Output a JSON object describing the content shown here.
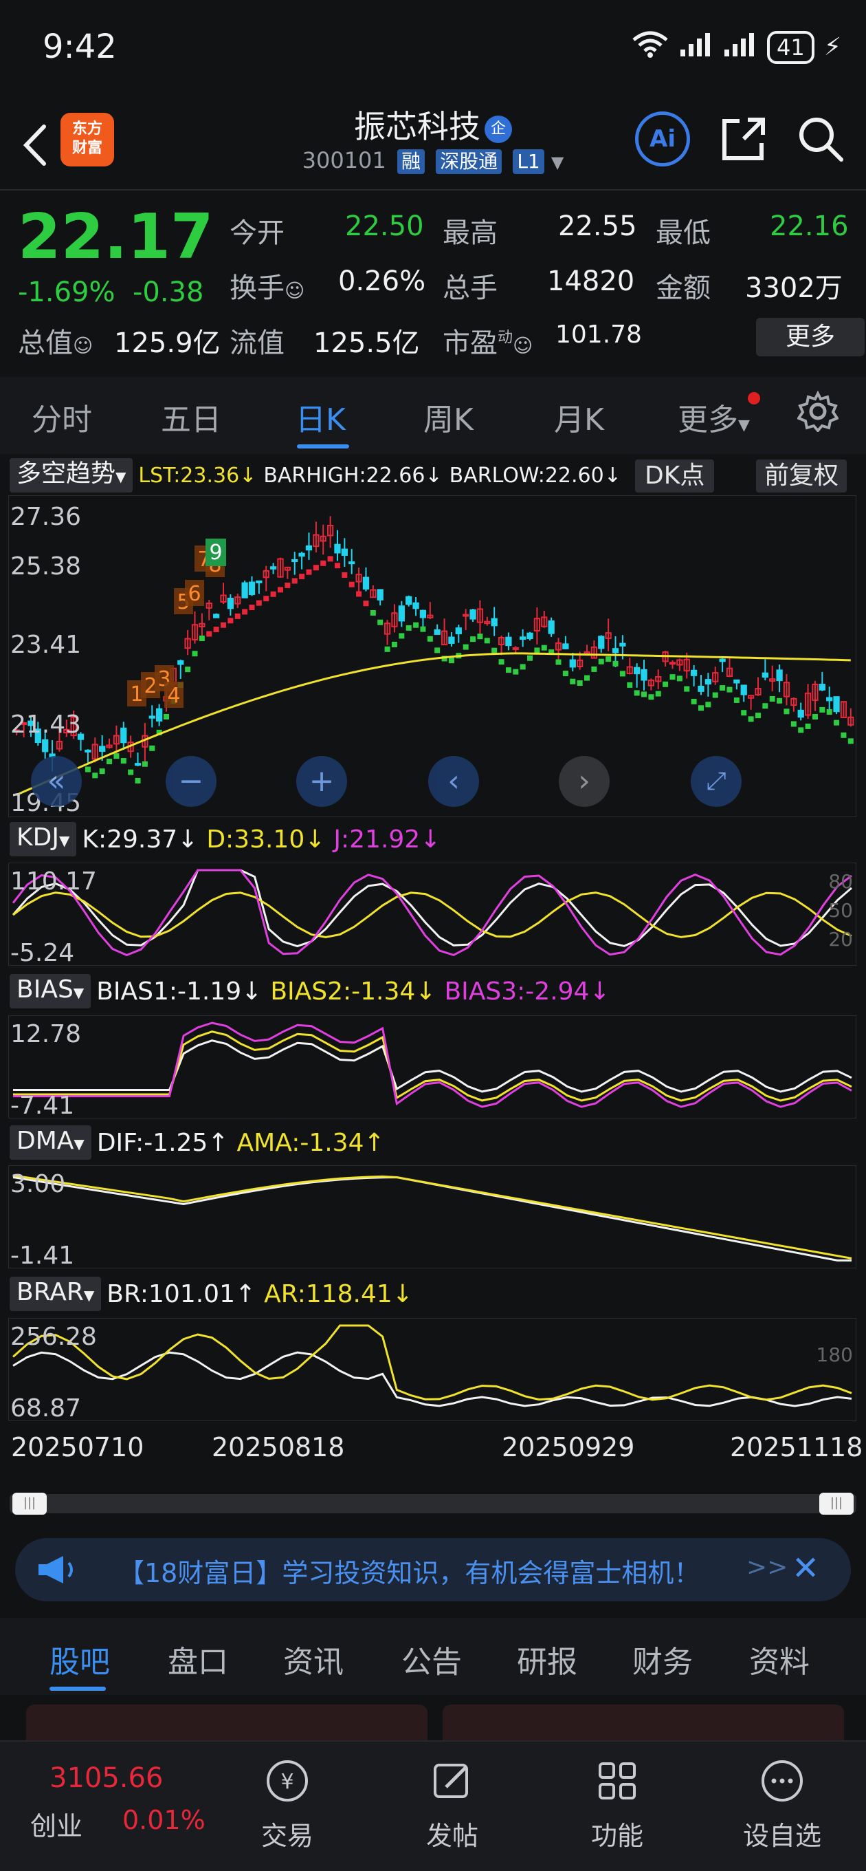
{
  "status": {
    "time": "9:42",
    "battery": "41"
  },
  "header": {
    "logo_line1": "东方",
    "logo_line2": "财富",
    "name": "振芯科技",
    "name_badge": "企",
    "code": "300101",
    "tags": [
      "融",
      "深股通",
      "L1"
    ],
    "ai_label": "Ai"
  },
  "quote": {
    "price": "22.17",
    "change_pct": "-1.69%",
    "change_amt": "-0.38",
    "open_label": "今开",
    "open": "22.50",
    "high_label": "最高",
    "high": "22.55",
    "low_label": "最低",
    "low": "22.16",
    "turnover_label": "换手",
    "turnover": "0.26%",
    "volume_label": "总手",
    "volume": "14820",
    "amount_label": "金额",
    "amount": "3302万",
    "mktcap_label": "总值",
    "mktcap": "125.9亿",
    "float_label": "流值",
    "float": "125.5亿",
    "pe_label": "市盈",
    "pe_sup": "动",
    "pe": "101.78",
    "more": "更多"
  },
  "period_tabs": [
    "分时",
    "五日",
    "日K",
    "周K",
    "月K",
    "更多"
  ],
  "main_indicator": {
    "name": "多空趋势",
    "lst": "LST:23.36↓",
    "barhigh": "BARHIGH:22.66↓",
    "barlow": "BARLOW:22.60↓",
    "dk": "DK点",
    "adjust": "前复权",
    "y_labels": [
      "27.36",
      "25.38",
      "23.41",
      "21.43",
      "19.45"
    ],
    "markers": [
      "1",
      "2",
      "3",
      "4",
      "5",
      "6",
      "7",
      "8",
      "9"
    ]
  },
  "kdj": {
    "name": "KDJ",
    "k": "K:29.37↓",
    "d": "D:33.10↓",
    "j": "J:21.92↓",
    "y_top": "110.17",
    "y_bot": "-5.24",
    "r1": "80",
    "r2": "50",
    "r3": "20"
  },
  "bias": {
    "name": "BIAS",
    "b1": "BIAS1:-1.19↓",
    "b2": "BIAS2:-1.34↓",
    "b3": "BIAS3:-2.94↓",
    "y_top": "12.78",
    "y_bot": "-7.41"
  },
  "dma": {
    "name": "DMA",
    "dif": "DIF:-1.25↑",
    "ama": "AMA:-1.34↑",
    "y_top": "3.00",
    "y_bot": "-1.41"
  },
  "brar": {
    "name": "BRAR",
    "br": "BR:101.01↑",
    "ar": "AR:118.41↓",
    "y_top": "256.28",
    "y_bot": "68.87",
    "r1": "180"
  },
  "dates": [
    "20250710",
    "20250818",
    "20250929",
    "20251118"
  ],
  "banner": {
    "text": "【18财富日】学习投资知识，有机会得富士相机！",
    "arrow": ">>"
  },
  "bottom_tabs": [
    "股吧",
    "盘口",
    "资讯",
    "公告",
    "研报",
    "财务",
    "资料"
  ],
  "nav": {
    "market_value": "3105.66",
    "market_name": "创业",
    "market_change": "0.01%",
    "items": [
      "交易",
      "发帖",
      "功能",
      "设自选"
    ]
  },
  "colors": {
    "up": "#e8283a",
    "down": "#2ecc40",
    "accent": "#3a8ef0",
    "ma": "#f1e22c"
  }
}
